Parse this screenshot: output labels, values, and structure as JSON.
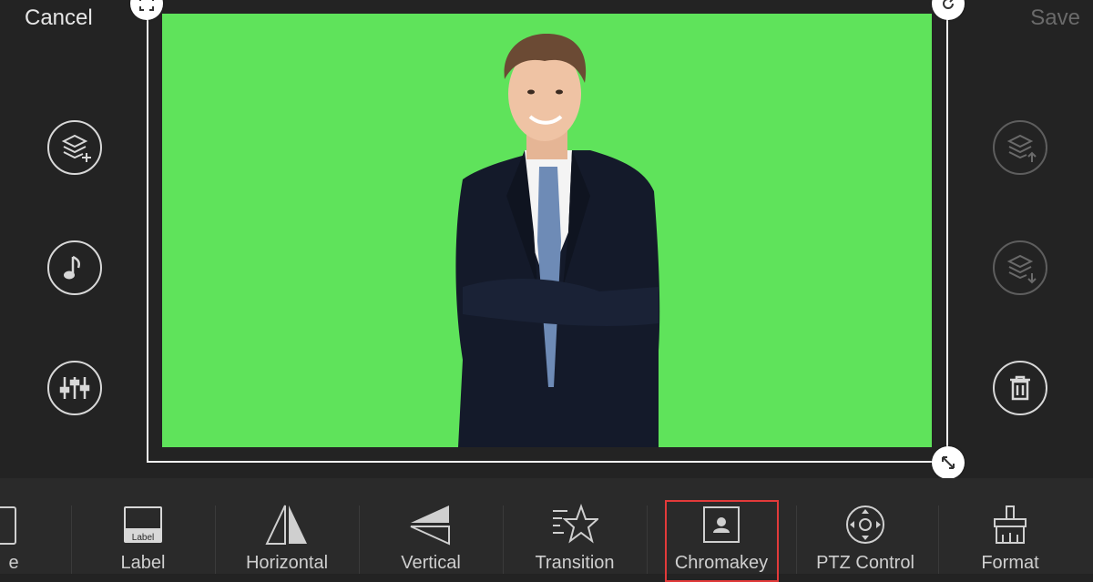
{
  "header": {
    "cancel_label": "Cancel",
    "save_label": "Save"
  },
  "toolbar": {
    "partial_label": "e",
    "items": [
      {
        "label": "Label",
        "icon_text": "Label",
        "icon": "label-icon"
      },
      {
        "label": "Horizontal",
        "icon": "flip-horizontal-icon"
      },
      {
        "label": "Vertical",
        "icon": "flip-vertical-icon"
      },
      {
        "label": "Transition",
        "icon": "transition-star-icon"
      },
      {
        "label": "Chromakey",
        "icon": "chromakey-icon"
      },
      {
        "label": "PTZ Control",
        "icon": "ptz-control-icon"
      },
      {
        "label": "Format",
        "icon": "format-brush-icon"
      }
    ],
    "selected": "Chromakey"
  },
  "colors": {
    "background": "#232323",
    "green_screen": "#5fe35b",
    "selection_outline": "#e23a3a",
    "toolbar": "#2a2a2a"
  }
}
